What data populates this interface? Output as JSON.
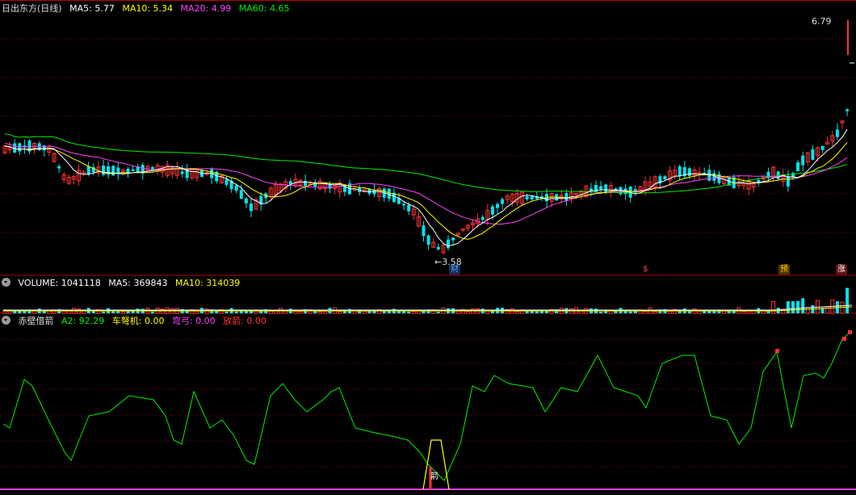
{
  "main": {
    "title": "日出东方(日线)",
    "ma": [
      {
        "label": "MA5:",
        "value": "5.77",
        "color": "#ffffff"
      },
      {
        "label": "MA10:",
        "value": "5.34",
        "color": "#ffff00"
      },
      {
        "label": "MA20:",
        "value": "4.99",
        "color": "#ff44ff"
      },
      {
        "label": "MA60:",
        "value": "4.65",
        "color": "#00ee00"
      }
    ],
    "high_label": "6.79",
    "low_label": "3.58",
    "markers": [
      {
        "text": "财",
        "color": "#44aaff"
      },
      {
        "text": "$",
        "color": "#ff4444"
      },
      {
        "text": "预",
        "color": "#ffcc00"
      },
      {
        "text": "涨",
        "color": "#ffffff"
      }
    ]
  },
  "volume": {
    "title": "VOLUME:",
    "value": "1041118",
    "ma5_label": "MA5:",
    "ma5_value": "369843",
    "ma10_label": "MA10:",
    "ma10_value": "314039"
  },
  "indicator": {
    "title": "赤壁借箭",
    "items": [
      {
        "label": "A2:",
        "value": "92.29",
        "color": "#00ee00"
      },
      {
        "label": "车弩机:",
        "value": "0.00",
        "color": "#ffff00"
      },
      {
        "label": "弯弓:",
        "value": "0.00",
        "color": "#ff44ff"
      },
      {
        "label": "放箭:",
        "value": "0.00",
        "color": "#ff3333"
      }
    ],
    "arrow_label": "箭"
  },
  "colors": {
    "up": "#ff3333",
    "down": "#00e5ee",
    "grid": "#7a0000",
    "ma5": "#ffffff",
    "ma10": "#ffff00",
    "ma20": "#ff44ff",
    "ma60": "#00ee00",
    "a2": "#00ee00"
  }
}
